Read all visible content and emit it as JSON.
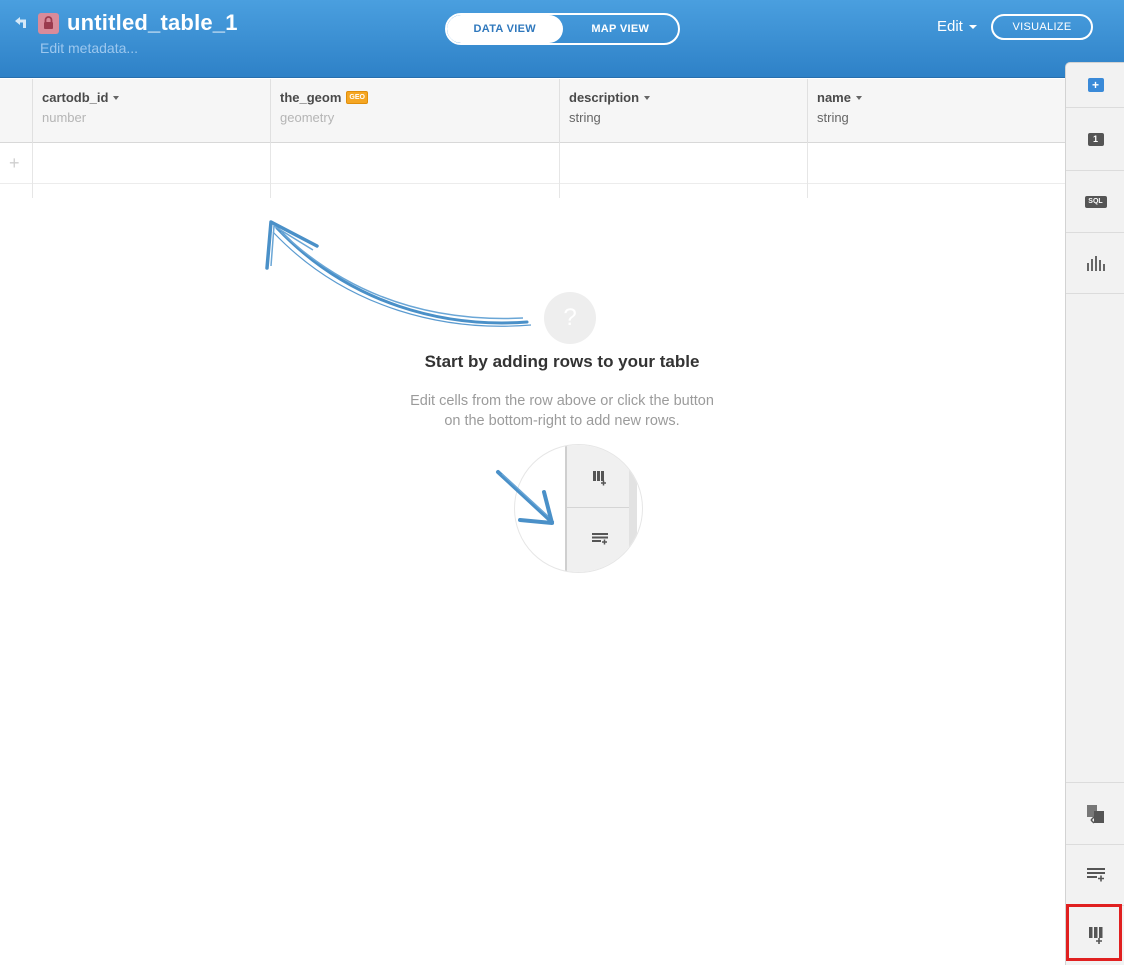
{
  "header": {
    "title": "untitled_table_1",
    "edit_metadata": "Edit metadata...",
    "view_tabs": [
      "DATA VIEW",
      "MAP VIEW"
    ],
    "active_tab": "DATA VIEW",
    "edit_menu_label": "Edit",
    "visualize_label": "VISUALIZE"
  },
  "table": {
    "columns": [
      {
        "name": "cartodb_id",
        "type": "number"
      },
      {
        "name": "the_geom",
        "type": "geometry",
        "badge": "GEO"
      },
      {
        "name": "description",
        "type": "string"
      },
      {
        "name": "name",
        "type": "string"
      }
    ],
    "add_row_symbol": "+"
  },
  "empty_state": {
    "icon_symbol": "?",
    "title": "Start by adding rows to your table",
    "description_line1": "Edit cells from the row above or click the button",
    "description_line2": "on the bottom-right to add new rows."
  },
  "right_sidebar": {
    "add_layer_symbol": "+",
    "layer_number": "1",
    "sql_label": "SQL",
    "icons": [
      "add-layer-icon",
      "layer-number-icon",
      "sql-icon",
      "chart-icon",
      "merge-tables-icon",
      "add-row-icon",
      "add-column-icon"
    ]
  },
  "colors": {
    "header_top": "#4a9fdf",
    "header_bottom": "#2e81c7",
    "accent_blue": "#3a8ad8",
    "geo_badge": "#f5a623",
    "highlight_red": "#e02020"
  }
}
